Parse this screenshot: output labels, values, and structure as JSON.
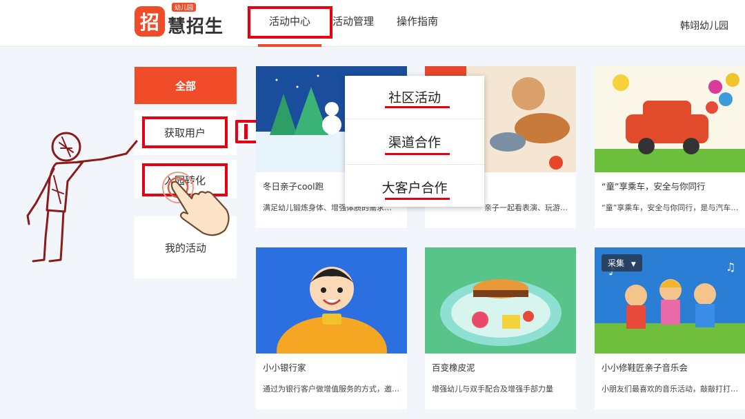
{
  "header": {
    "logo_tag": "幼儿园",
    "logo_badge": "招",
    "logo_text": "慧招生",
    "nav": [
      "活动中心",
      "活动管理",
      "操作指南"
    ],
    "school": "韩翊幼儿园"
  },
  "sidebar": {
    "items": [
      {
        "label": "全部"
      },
      {
        "label": "获取用户"
      },
      {
        "label": "入园转化"
      },
      {
        "label": "我的活动"
      }
    ]
  },
  "dropdown": {
    "items": [
      "社区活动",
      "渠道合作",
      "大客户合作"
    ]
  },
  "cards": [
    {
      "title": "冬日亲子cool跑",
      "desc": "满足幼儿锻炼身体、增强体质的需求…"
    },
    {
      "title": "",
      "desc": "亲子一起看表演、玩游…"
    },
    {
      "title": "“童”享乘车，安全与你同行",
      "desc": "“童”享乘车，安全与你同行，是与汽车…"
    },
    {
      "title": "小小银行家",
      "desc": "通过为银行客户做增值服务的方式，邀…"
    },
    {
      "title": "百变橡皮泥",
      "desc": "增强幼儿与双手配合及增强手部力量"
    },
    {
      "title": "小小修鞋匠亲子音乐会",
      "desc": "小朋友们最喜欢的音乐活动，敲敲打打…"
    }
  ],
  "collect_label": "采集",
  "colors": {
    "accent": "#f04c2a",
    "annotation_red": "#e60012"
  }
}
